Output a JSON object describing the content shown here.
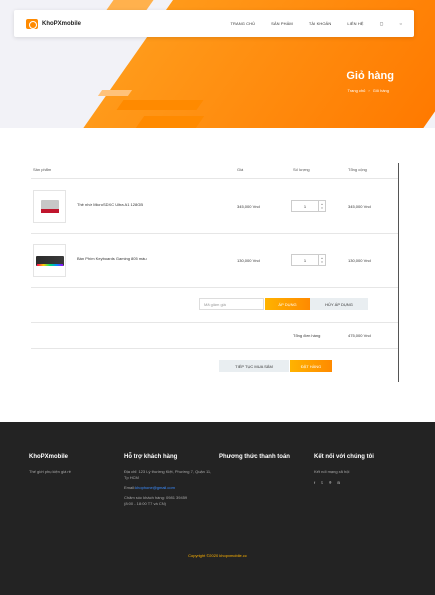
{
  "brand": {
    "name": "KhoPXmobile",
    "accent": "#ff8a00"
  },
  "nav": {
    "items": [
      "TRANG CHỦ",
      "SẢN PHẨM",
      "TÀI KHOẢN",
      "LIÊN HỆ"
    ],
    "icons": [
      "cart-icon",
      "search-icon"
    ]
  },
  "hero": {
    "title": "Giỏ hàng",
    "breadcrumb": [
      "Trang chủ",
      "›",
      "Giỏ hàng"
    ]
  },
  "cart": {
    "headers": [
      "Sản phẩm",
      "Giá",
      "Số lượng",
      "Tổng cộng"
    ],
    "items": [
      {
        "name": "Thẻ nhớ MicroSDXC Ultra A1 128GB",
        "price": "345,000 Vnd",
        "qty": "1",
        "total": "345,000 Vnd",
        "image": "memory-card-image"
      },
      {
        "name": "Bàn Phím Keyboards Gaming 805 màu",
        "price": "130,000 Vnd",
        "qty": "1",
        "total": "130,000 Vnd",
        "image": "keyboard-image"
      }
    ],
    "coupon_placeholder": "Mã giảm giá",
    "apply_label": "ÁP DỤNG",
    "cancel_label": "HỦY ÁP DỤNG",
    "total_label": "Tổng đơn hàng",
    "total_value": "475,000 Vnd",
    "continue_label": "TIẾP TỤC MUA SẮM",
    "order_label": "ĐẶT HÀNG"
  },
  "footer": {
    "about": {
      "title": "KhoPXmobile",
      "text": "Thế giới phụ kiện giá rẻ"
    },
    "support": {
      "title": "Hỗ trợ khách hàng",
      "address": "Địa chỉ: 123 Lý thường Kiệt, Phường 7, Quận 11, Tp HCM",
      "email_label": "Email:",
      "email": "khophone@gmail.com",
      "hotline": "Chăm sóc khách hàng: 0981 39459",
      "hours": "(8:00 - 18:00 T7 và CN)"
    },
    "payment": {
      "title": "Phương thức thanh toán"
    },
    "social": {
      "title": "Kết nối với chúng tôi",
      "text": "Kết nối mạng xã hội",
      "icons": [
        "f",
        "𝕥",
        "⌾",
        "B"
      ]
    },
    "copyright": "Copyright ©2020 khopxmobile.cc"
  }
}
